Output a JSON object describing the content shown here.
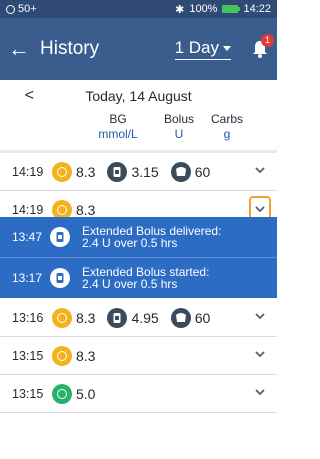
{
  "status_bar": {
    "left_text": "50+",
    "battery": "100%",
    "time": "14:22"
  },
  "header": {
    "title": "History",
    "range": "1 Day",
    "notification_count": "1"
  },
  "date_nav": {
    "label": "Today, 14 August"
  },
  "columns": {
    "bg": {
      "label": "BG",
      "unit": "mmol/L"
    },
    "bolus": {
      "label": "Bolus",
      "unit": "U"
    },
    "carbs": {
      "label": "Carbs",
      "unit": "g"
    }
  },
  "rows": [
    {
      "time": "14:19",
      "bg": "8.3",
      "bolus": "3.15",
      "carbs": "60"
    },
    {
      "time": "14:19",
      "bg": "8.3"
    },
    {
      "time": "13:47",
      "line1": "Extended Bolus delivered:",
      "line2": "2.4 U over 0.5 hrs"
    },
    {
      "time": "13:17",
      "line1": "Extended Bolus started:",
      "line2": "2.4 U over 0.5 hrs"
    },
    {
      "time": "13:16",
      "bg": "8.3",
      "bolus": "4.95",
      "carbs": "60"
    },
    {
      "time": "13:15",
      "bg": "8.3"
    },
    {
      "time": "13:15",
      "bg": "5.0"
    }
  ],
  "colors": {
    "bg_orange": "#f5b21f",
    "bg_green": "#27b26b",
    "event_blue": "#2d6cc4",
    "header_blue": "#3a5d8e"
  }
}
